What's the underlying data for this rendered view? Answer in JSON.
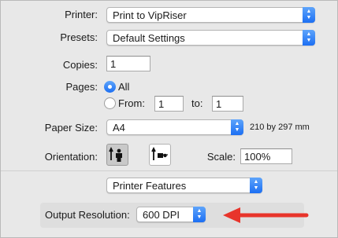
{
  "printer": {
    "label": "Printer:",
    "value": "Print to VipRiser"
  },
  "presets": {
    "label": "Presets:",
    "value": "Default Settings"
  },
  "copies": {
    "label": "Copies:",
    "value": "1"
  },
  "pages": {
    "label": "Pages:",
    "all_label": "All",
    "from_label": "From:",
    "from_value": "1",
    "to_label": "to:",
    "to_value": "1",
    "selected": "All"
  },
  "paper_size": {
    "label": "Paper Size:",
    "value": "A4",
    "dimensions": "210 by 297 mm"
  },
  "orientation": {
    "label": "Orientation:",
    "options": [
      "portrait",
      "landscape"
    ],
    "selected": "portrait"
  },
  "scale": {
    "label": "Scale:",
    "value": "100%"
  },
  "section_select": {
    "value": "Printer Features"
  },
  "output_resolution": {
    "label": "Output Resolution:",
    "value": "600 DPI"
  },
  "colors": {
    "accent": "#1c6ff3",
    "arrow": "#e8342b"
  },
  "icons": [
    "portrait-orientation-icon",
    "landscape-orientation-icon",
    "stepper-icon",
    "arrow-icon"
  ]
}
